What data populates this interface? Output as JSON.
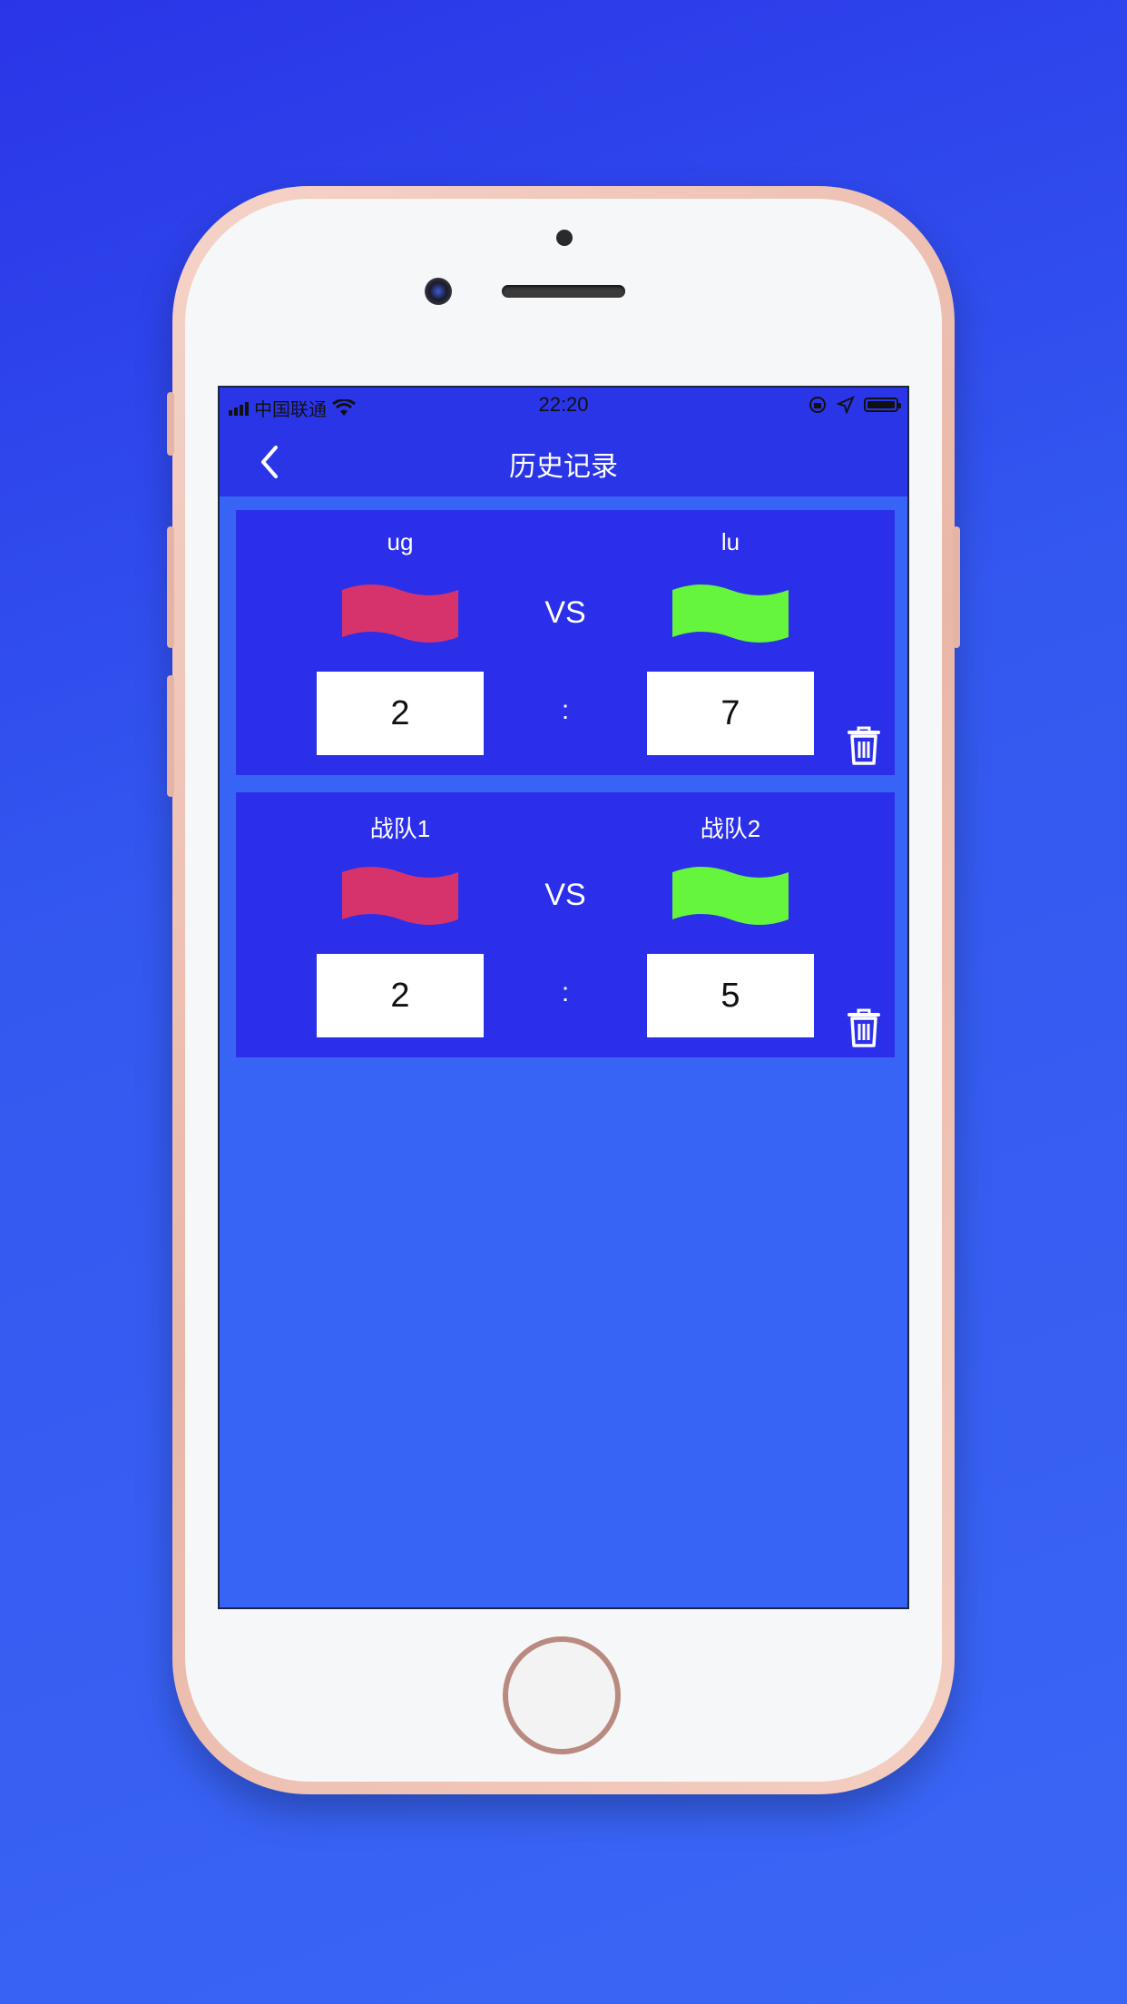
{
  "status_bar": {
    "carrier": "中国联通",
    "time": "22:20"
  },
  "nav": {
    "title": "历史记录",
    "back_icon": "chevron-left-icon"
  },
  "records": [
    {
      "team1": "ug",
      "team2": "lu",
      "vs": "VS",
      "score1": "2",
      "score2": "7",
      "separator": ":",
      "team1_flag_color": "#d6336c",
      "team2_flag_color": "#64f53c"
    },
    {
      "team1": "战队1",
      "team2": "战队2",
      "vs": "VS",
      "score1": "2",
      "score2": "5",
      "separator": ":",
      "team1_flag_color": "#d6336c",
      "team2_flag_color": "#64f53c"
    }
  ],
  "colors": {
    "background": "#3764f4",
    "bar": "#2b35e8",
    "card": "#2b2fe9"
  }
}
